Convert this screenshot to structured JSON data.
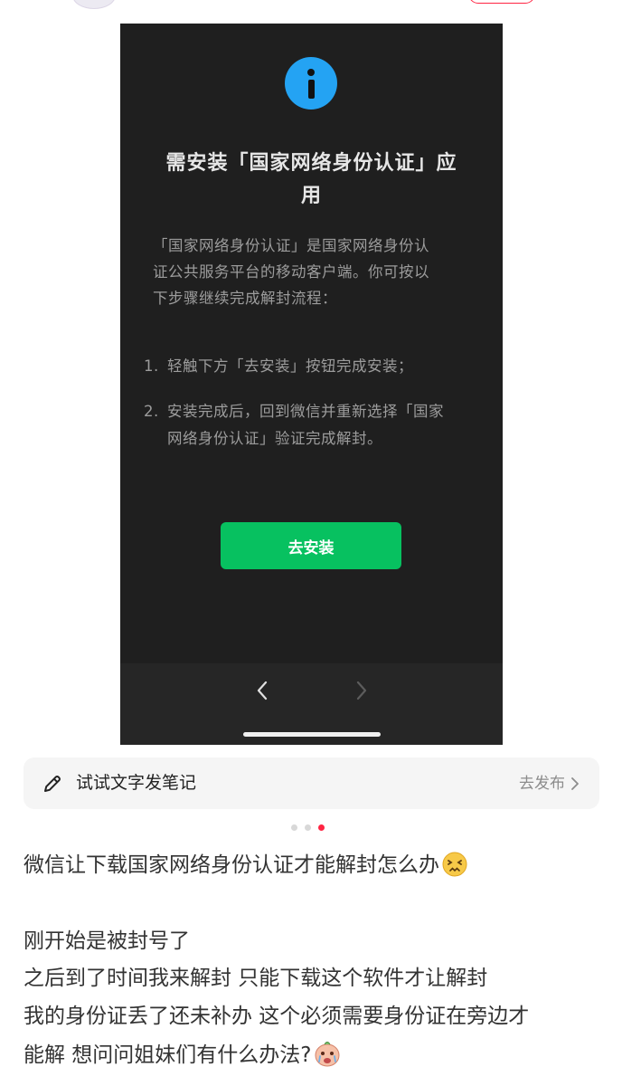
{
  "dialog": {
    "title_line1": "需安装「国家网络身份认证」应",
    "title_line2": "用",
    "body_lines": [
      "「国家网络身份认证」是国家网络身份认",
      "证公共服务平台的移动客户端。你可按以",
      "下步骤继续完成解封流程："
    ],
    "steps": [
      {
        "num": "1.",
        "lines": [
          "轻触下方「去安装」按钮完成安装；"
        ]
      },
      {
        "num": "2.",
        "lines": [
          "安装完成后，回到微信并重新选择「国家",
          "网络身份认证」验证完成解封。"
        ]
      }
    ],
    "install_button": "去安装",
    "icon": "info-icon",
    "accent_color": "#07c160",
    "info_color": "#24a3f3"
  },
  "browser_nav": {
    "back_icon": "chevron-left-icon",
    "forward_icon": "chevron-right-icon"
  },
  "text_note": {
    "label": "试试文字发笔记",
    "publish_label": "去发布",
    "icon": "pencil-icon"
  },
  "pager": {
    "count": 3,
    "active_index": 2,
    "active_color": "#ff2442"
  },
  "post": {
    "title": "微信让下载国家网络身份认证才能解封怎么办",
    "lines": [
      "刚开始是被封号了",
      "之后到了时间我来解封 只能下载这个软件才让解封",
      "我的身份证丢了还未补办 这个必须需要身份证在旁边才",
      "能解 想问问姐妹们有什么办法?"
    ]
  }
}
